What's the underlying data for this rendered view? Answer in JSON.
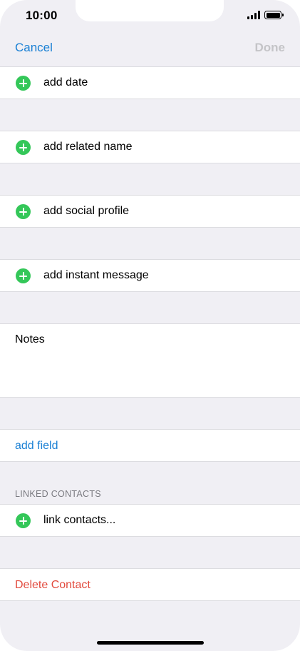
{
  "status_bar": {
    "time": "10:00"
  },
  "nav": {
    "cancel_label": "Cancel",
    "done_label": "Done"
  },
  "rows": {
    "add_date": "add date",
    "add_related_name": "add related name",
    "add_social_profile": "add social profile",
    "add_instant_message": "add instant message",
    "notes": "Notes",
    "add_field": "add field",
    "linked_contacts_header": "LINKED CONTACTS",
    "link_contacts": "link contacts...",
    "delete_contact": "Delete Contact"
  },
  "colors": {
    "accent": "#1a80d4",
    "destructive": "#e24a3d",
    "add_green": "#34c759",
    "disabled": "#c4c4c7",
    "background": "#f0eff4"
  },
  "icons": {
    "add": "plus-circle-icon",
    "signal": "cellular-signal-icon",
    "battery": "battery-icon"
  }
}
